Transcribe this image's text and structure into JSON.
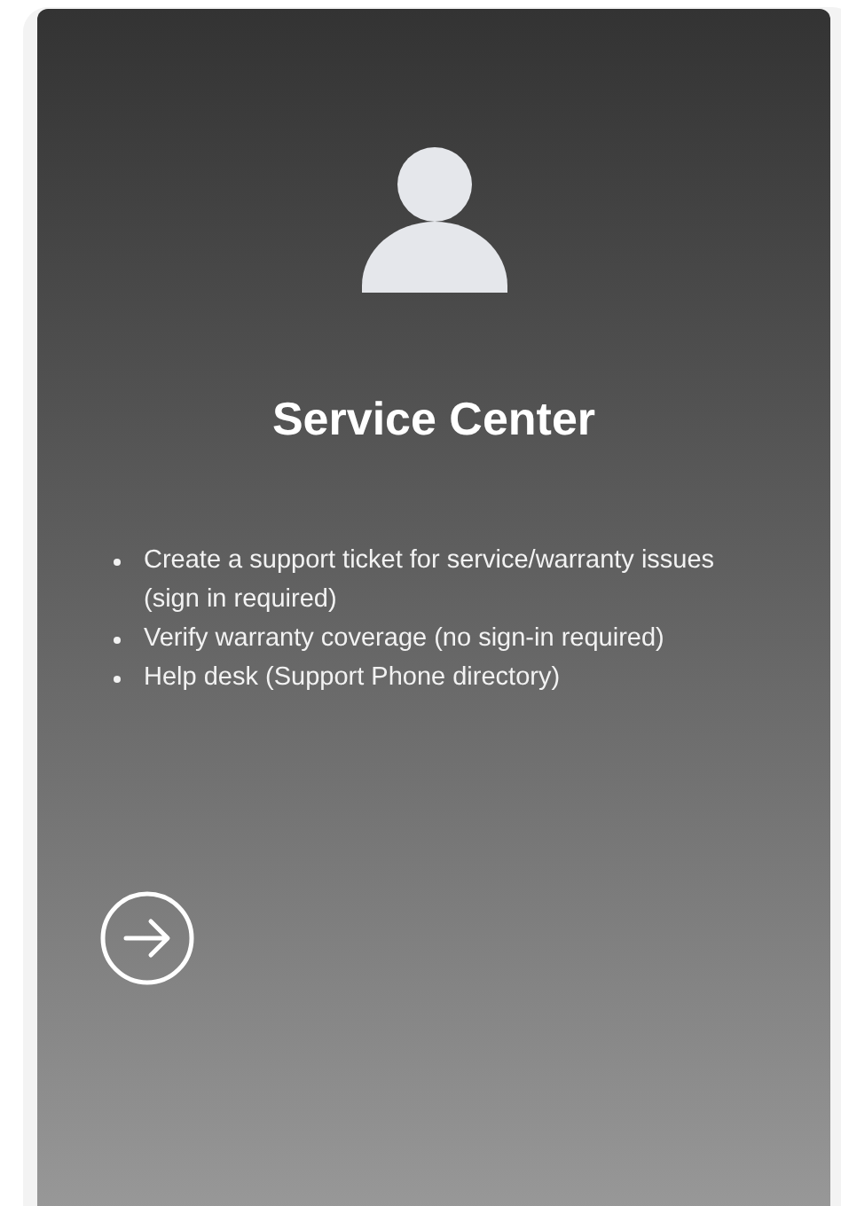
{
  "card": {
    "title": "Service Center",
    "items": [
      "Create a support ticket for service/warranty issues (sign in required)",
      "Verify warranty coverage (no sign-in required)",
      "Help desk (Support Phone directory)"
    ]
  }
}
